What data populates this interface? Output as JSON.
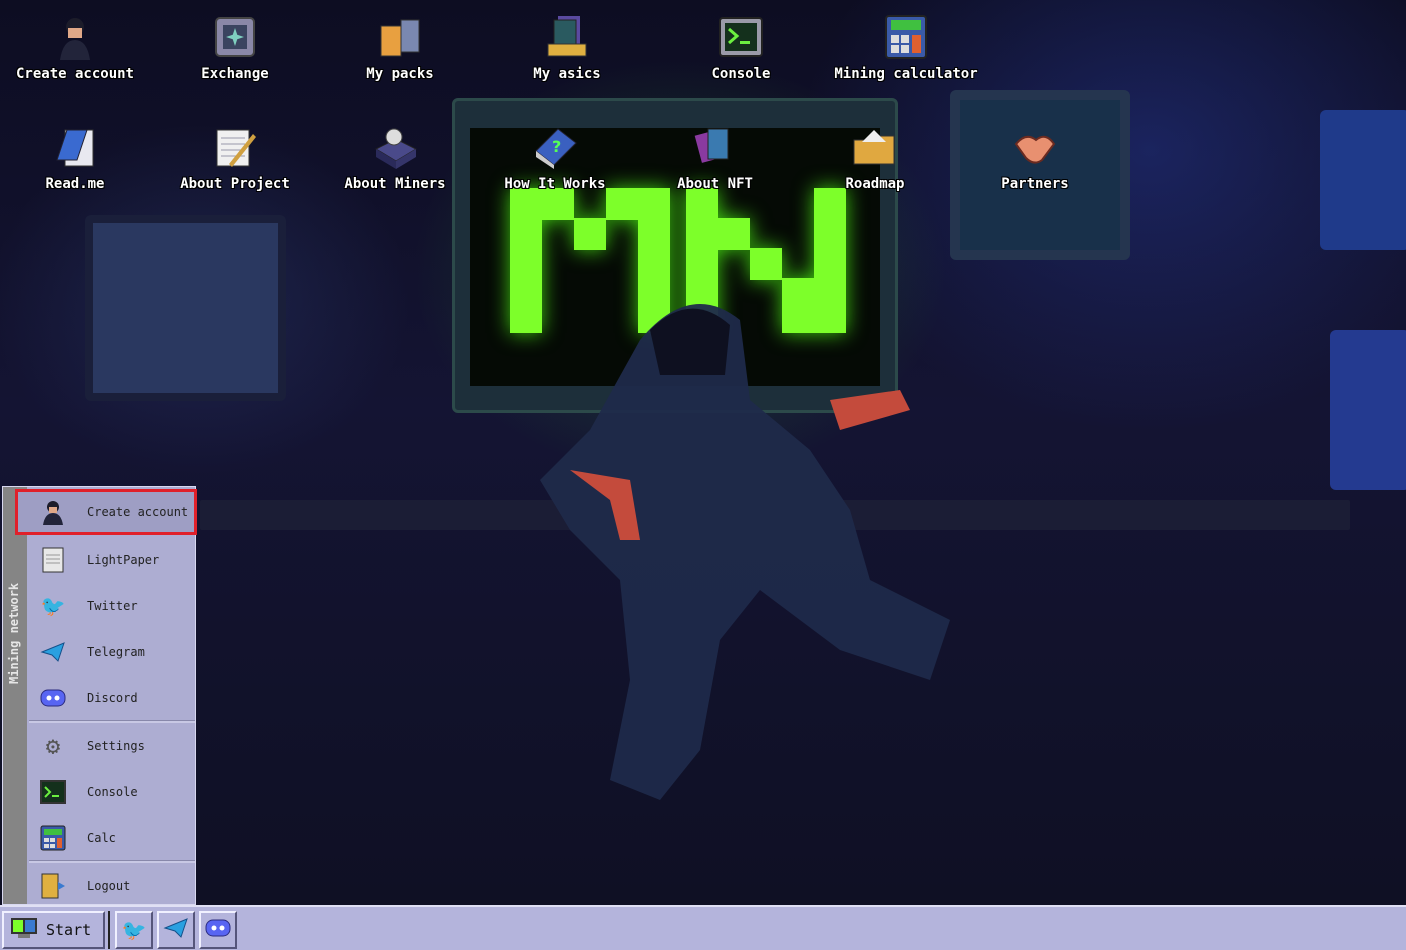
{
  "desktop": {
    "row1": [
      {
        "label": "Create account",
        "icon": "hacker-avatar-icon"
      },
      {
        "label": "Exchange",
        "icon": "safe-icon"
      },
      {
        "label": "My packs",
        "icon": "packs-icon"
      },
      {
        "label": "My asics",
        "icon": "asics-icon"
      },
      {
        "label": "Console",
        "icon": "console-icon"
      },
      {
        "label": "Mining calculator",
        "icon": "calculator-icon"
      }
    ],
    "row2": [
      {
        "label": "Read.me",
        "icon": "notepad-icon"
      },
      {
        "label": "About Project",
        "icon": "notebook-pen-icon"
      },
      {
        "label": "About Miners",
        "icon": "miner-gear-icon"
      },
      {
        "label": "How It Works",
        "icon": "help-book-icon"
      },
      {
        "label": "About NFT",
        "icon": "nft-cards-icon"
      },
      {
        "label": "Roadmap",
        "icon": "folder-icon"
      },
      {
        "label": "Partners",
        "icon": "handshake-icon"
      }
    ]
  },
  "start_menu": {
    "sidebar_title": "Mining network",
    "items": [
      {
        "label": "Create account",
        "icon": "hacker-avatar-icon",
        "selected": true
      },
      {
        "label": "LightPaper",
        "icon": "document-icon"
      },
      {
        "label": "Twitter",
        "icon": "twitter-icon"
      },
      {
        "label": "Telegram",
        "icon": "telegram-icon"
      },
      {
        "label": "Discord",
        "icon": "discord-icon"
      },
      {
        "label": "Settings",
        "icon": "gear-icon"
      },
      {
        "label": "Console",
        "icon": "console-icon"
      },
      {
        "label": "Calc",
        "icon": "calculator-icon"
      },
      {
        "label": "Logout",
        "icon": "logout-door-icon"
      }
    ]
  },
  "taskbar": {
    "start_label": "Start",
    "quick_launch": [
      "twitter-icon",
      "telegram-icon",
      "discord-icon"
    ]
  },
  "colors": {
    "highlight_border": "#e0202a",
    "menu_bg": "#adadd2",
    "taskbar_bg": "#b4b4dc",
    "screen_green": "#7dff2a"
  }
}
